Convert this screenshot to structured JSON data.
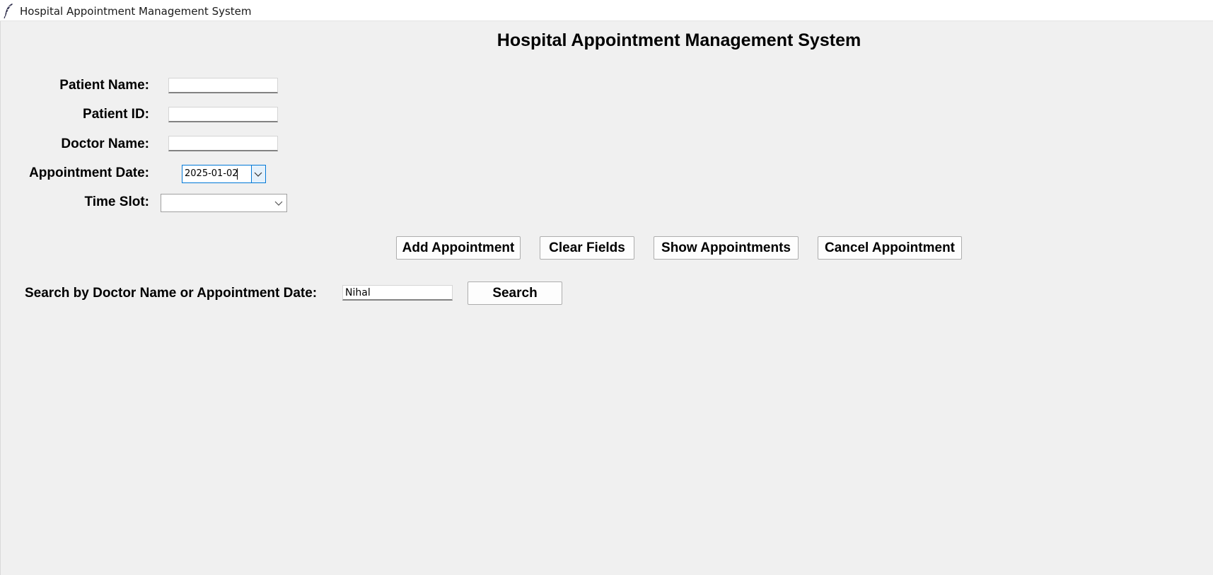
{
  "window": {
    "title": "Hospital Appointment Management System",
    "icon": "feather-icon"
  },
  "main": {
    "heading": "Hospital Appointment Management System"
  },
  "form": {
    "patient_name": {
      "label": "Patient Name:",
      "value": ""
    },
    "patient_id": {
      "label": "Patient ID:",
      "value": ""
    },
    "doctor_name": {
      "label": "Doctor Name:",
      "value": ""
    },
    "appointment_date": {
      "label": "Appointment Date:",
      "value": "2025-01-02",
      "icon": "chevron-down-icon"
    },
    "time_slot": {
      "label": "Time Slot:",
      "value": "",
      "icon": "chevron-down-icon"
    }
  },
  "actions": {
    "add": "Add Appointment",
    "clear": "Clear Fields",
    "show": "Show Appointments",
    "cancel": "Cancel Appointment"
  },
  "search": {
    "label": "Search by Doctor Name or Appointment Date:",
    "value": "Nihal",
    "button": "Search"
  },
  "colors": {
    "background": "#f0f0f0",
    "focus_accent": "#0078d7",
    "dropdown_highlight": "#e5f1fb"
  }
}
